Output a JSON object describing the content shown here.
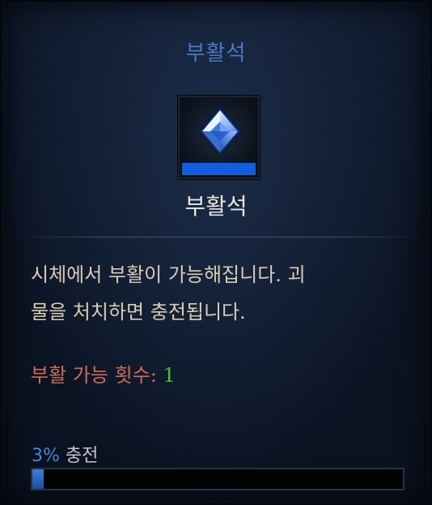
{
  "tooltip": {
    "title": "부활석",
    "item_name": "부활석",
    "description_line1": "시체에서 부활이 가능해집니다. 괴",
    "description_line2": "물을 처치하면 충전됩니다.",
    "revive_label": "부활 가능 횟수: ",
    "revive_count": "1",
    "charge_percent_text": "3%",
    "charge_word": " 충전",
    "charge_fraction": 0.03,
    "icon": "gem-icon"
  },
  "colors": {
    "title": "#4a78c4",
    "revive_label": "#cc6d55",
    "revive_count": "#4bbf2f",
    "charge_bar": "#2f6fd0",
    "icon_strip": "#0f5fe0"
  }
}
